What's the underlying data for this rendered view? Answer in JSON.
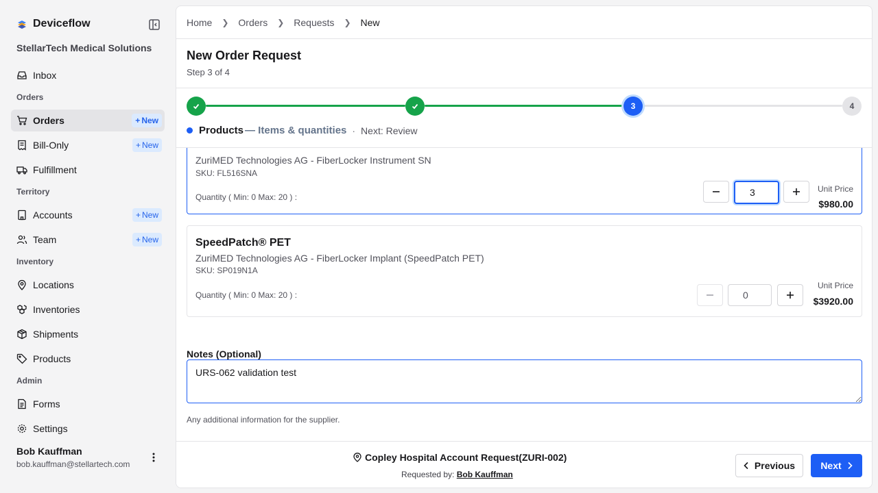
{
  "app": {
    "name": "Deviceflow",
    "org": "StellarTech Medical Solutions"
  },
  "sidebar": {
    "inbox": "Inbox",
    "sections": {
      "orders": "Orders",
      "territory": "Territory",
      "inventory": "Inventory",
      "admin": "Admin"
    },
    "items": {
      "orders": "Orders",
      "bill_only": "Bill-Only",
      "fulfillment": "Fulfillment",
      "accounts": "Accounts",
      "team": "Team",
      "locations": "Locations",
      "inventories": "Inventories",
      "shipments": "Shipments",
      "products": "Products",
      "forms": "Forms",
      "settings": "Settings"
    },
    "new_badge": "New",
    "active_item": "orders"
  },
  "user": {
    "name": "Bob Kauffman",
    "email": "bob.kauffman@stellartech.com"
  },
  "breadcrumb": [
    "Home",
    "Orders",
    "Requests",
    "New"
  ],
  "page": {
    "title": "New Order Request",
    "subtitle": "Step 3 of 4"
  },
  "stepper": {
    "current_step": 3,
    "total_steps": 4,
    "step3_label": "3",
    "step4_label": "4",
    "caption_title": "Products",
    "caption_desc": "— Items & quantities",
    "caption_sep": "·",
    "caption_next": "Next: Review"
  },
  "products": [
    {
      "name": "",
      "manufacturer": "ZuriMED Technologies AG - FiberLocker Instrument SN",
      "sku": "SKU: FL516SNA",
      "quantity_label": "Quantity ( Min: 0 Max: 20 ) :",
      "quantity": "3",
      "unit_price_label": "Unit Price",
      "unit_price": "$980.00"
    },
    {
      "name": "SpeedPatch® PET",
      "manufacturer": "ZuriMED Technologies AG - FiberLocker Implant (SpeedPatch PET)",
      "sku": "SKU: SP019N1A",
      "quantity_label": "Quantity ( Min: 0 Max: 20 ) :",
      "quantity": "0",
      "unit_price_label": "Unit Price",
      "unit_price": "$3920.00"
    }
  ],
  "notes": {
    "label": "Notes (Optional)",
    "value": "URS-062 validation test",
    "help": "Any additional information for the supplier."
  },
  "footer": {
    "account": "Copley Hospital Account Request(ZURI-002)",
    "requested_by_label": "Requested by:",
    "requested_by": "Bob Kauffman",
    "previous": "Previous",
    "next": "Next"
  },
  "colors": {
    "primary": "#1d5ef5",
    "success": "#16a34a",
    "badge_bg": "#dbeafe"
  }
}
